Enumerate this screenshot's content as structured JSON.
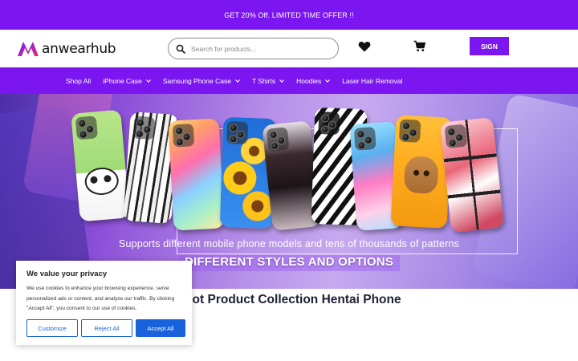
{
  "announcement": {
    "text": "GET 20% Off. LIMITED TIME OFFER !!"
  },
  "header": {
    "logo_text": "anwearhub",
    "search_placeholder": "Search for products...",
    "search_value": "",
    "sign_label": "SIGN",
    "icons": {
      "search": "search-icon",
      "wishlist": "heart-icon",
      "cart": "cart-icon",
      "logo": "logo-mark"
    }
  },
  "nav": {
    "items": [
      {
        "label": "Shop All",
        "has_dropdown": false
      },
      {
        "label": "iPhone Case",
        "has_dropdown": true
      },
      {
        "label": "Samsung Phone Case",
        "has_dropdown": true
      },
      {
        "label": "T Shirts",
        "has_dropdown": true
      },
      {
        "label": "Hoodies",
        "has_dropdown": true
      },
      {
        "label": "Laser Hair Removal",
        "has_dropdown": false
      }
    ]
  },
  "hero": {
    "line1": "Supports different mobile phone models and tens of thousands of patterns",
    "line2": "DIFFERENT STYLES AND OPTIONS"
  },
  "main": {
    "headline": "Hot Product Collection Hentai Phone"
  },
  "cookie_banner": {
    "title": "We value your privacy",
    "text": "We use cookies to enhance your browsing experience, serve personalized ads or content, and analyze our traffic. By clicking \"Accept All\", you consent to our use of cookies.",
    "customize_label": "Customize",
    "reject_label": "Reject All",
    "accept_label": "Accept All"
  },
  "colors": {
    "brand_purple": "#7b16f0",
    "cookie_blue": "#1863dc",
    "headline": "#1c2033"
  }
}
